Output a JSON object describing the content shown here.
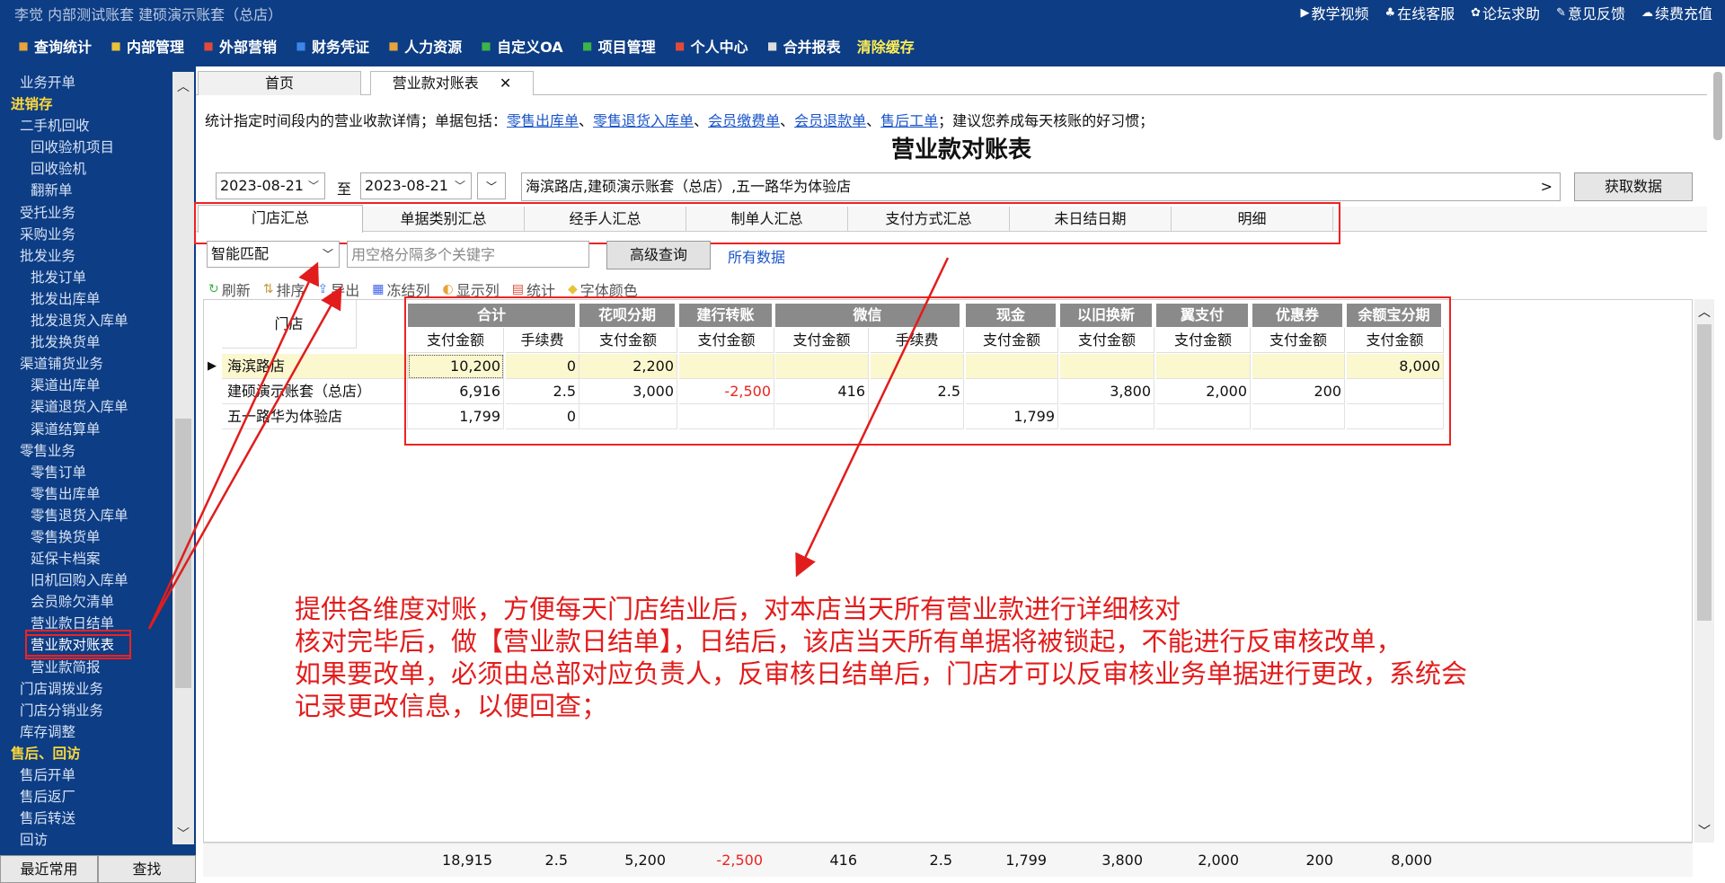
{
  "header": {
    "title": "李觉  内部测试账套    建硕演示账套（总店）",
    "links": [
      {
        "icon": "▶",
        "label": "教学视频"
      },
      {
        "icon": "♣",
        "label": "在线客服"
      },
      {
        "icon": "✿",
        "label": "论坛求助"
      },
      {
        "icon": "✎",
        "label": "意见反馈"
      },
      {
        "icon": "☁",
        "label": "续费充值"
      }
    ]
  },
  "menu": [
    {
      "label": "查询统计",
      "icon": "chart-icon",
      "color": "#e8a33b"
    },
    {
      "label": "内部管理",
      "icon": "pencil-icon",
      "color": "#e8c23b"
    },
    {
      "label": "外部营销",
      "icon": "bag-icon",
      "color": "#e04a3b"
    },
    {
      "label": "财务凭证",
      "icon": "document-icon",
      "color": "#3b86e8"
    },
    {
      "label": "人力资源",
      "icon": "person-icon",
      "color": "#e8a33b"
    },
    {
      "label": "自定义OA",
      "icon": "tools-icon",
      "color": "#3bb44a"
    },
    {
      "label": "项目管理",
      "icon": "gear-icon",
      "color": "#3bb44a"
    },
    {
      "label": "个人中心",
      "icon": "heart-icon",
      "color": "#e04a3b"
    },
    {
      "label": "合并报表",
      "icon": "file-icon",
      "color": "#dddddd"
    },
    {
      "label": "清除缓存",
      "icon": "",
      "color": ""
    }
  ],
  "sidebar": {
    "items": [
      {
        "label": "业务开单",
        "level": 1
      },
      {
        "label": "进销存",
        "level": 0
      },
      {
        "label": "二手机回收",
        "level": 1
      },
      {
        "label": "回收验机项目",
        "level": 2
      },
      {
        "label": "回收验机",
        "level": 2
      },
      {
        "label": "翻新单",
        "level": 2
      },
      {
        "label": "受托业务",
        "level": 1
      },
      {
        "label": "采购业务",
        "level": 1
      },
      {
        "label": "批发业务",
        "level": 1
      },
      {
        "label": "批发订单",
        "level": 2
      },
      {
        "label": "批发出库单",
        "level": 2
      },
      {
        "label": "批发退货入库单",
        "level": 2
      },
      {
        "label": "批发换货单",
        "level": 2
      },
      {
        "label": "渠道铺货业务",
        "level": 1
      },
      {
        "label": "渠道出库单",
        "level": 2
      },
      {
        "label": "渠道退货入库单",
        "level": 2
      },
      {
        "label": "渠道结算单",
        "level": 2
      },
      {
        "label": "零售业务",
        "level": 1
      },
      {
        "label": "零售订单",
        "level": 2
      },
      {
        "label": "零售出库单",
        "level": 2
      },
      {
        "label": "零售退货入库单",
        "level": 2
      },
      {
        "label": "零售换货单",
        "level": 2
      },
      {
        "label": "延保卡档案",
        "level": 2
      },
      {
        "label": "旧机回购入库单",
        "level": 2
      },
      {
        "label": "会员赊欠清单",
        "level": 2
      },
      {
        "label": "营业款日结单",
        "level": 2
      },
      {
        "label": "营业款对账表",
        "level": 2,
        "selected": true
      },
      {
        "label": "营业款简报",
        "level": 2
      },
      {
        "label": "门店调拨业务",
        "level": 1
      },
      {
        "label": "门店分销业务",
        "level": 1
      },
      {
        "label": "库存调整",
        "level": 1
      },
      {
        "label": "售后、回访",
        "level": 0
      },
      {
        "label": "售后开单",
        "level": 1
      },
      {
        "label": "售后返厂",
        "level": 1
      },
      {
        "label": "售后转送",
        "level": 1
      },
      {
        "label": "回访",
        "level": 1
      }
    ],
    "recent_label": "最近常用",
    "find_label": "查找"
  },
  "tabs": {
    "home": "首页",
    "active": "营业款对账表",
    "close": "✕"
  },
  "desc": {
    "prefix": "统计指定时间段内的营业收款详情；单据包括：",
    "links": [
      "零售出库单",
      "零售退货入库单",
      "会员缴费单",
      "会员退款单",
      "售后工单"
    ],
    "sep": "、",
    "suffix": "；建议您养成每天核账的好习惯；"
  },
  "report_title": "营业款对账表",
  "filters": {
    "date_from": "2023-08-21",
    "to": "至",
    "date_to": "2023-08-21",
    "stores": "海滨路店,建硕演示账套（总店）,五一路华为体验店",
    "stores_arrow": ">",
    "fetch": "获取数据"
  },
  "subtabs": [
    "门店汇总",
    "单据类别汇总",
    "经手人汇总",
    "制单人汇总",
    "支付方式汇总",
    "未日结日期",
    "明细"
  ],
  "search": {
    "mode": "智能匹配",
    "placeholder": "用空格分隔多个关键字",
    "advanced": "高级查询",
    "all": "所有数据"
  },
  "toolbar": [
    {
      "icon": "↻",
      "label": "刷新"
    },
    {
      "icon": "⇅",
      "label": "排序"
    },
    {
      "icon": "⇪",
      "label": "导出"
    },
    {
      "icon": "▦",
      "label": "冻结列"
    },
    {
      "icon": "◐",
      "label": "显示列"
    },
    {
      "icon": "▤",
      "label": "统计"
    },
    {
      "icon": "◆",
      "label": "字体颜色"
    }
  ],
  "table": {
    "store_header": "门店",
    "groups": [
      "合计",
      "花呗分期",
      "建行转账",
      "微信",
      "现金",
      "以旧换新",
      "翼支付",
      "优惠券",
      "余额宝分期"
    ],
    "sub": [
      "支付金额",
      "手续费",
      "支付金额",
      "支付金额",
      "支付金额",
      "手续费",
      "支付金额",
      "支付金额",
      "支付金额",
      "支付金额",
      "支付金额"
    ],
    "rows": [
      {
        "name": "海滨路店",
        "cells": [
          "10,200",
          "0",
          "2,200",
          "",
          "",
          "",
          "",
          "",
          "",
          "",
          "8,000"
        ]
      },
      {
        "name": "建硕演示账套（总店）",
        "cells": [
          "6,916",
          "2.5",
          "3,000",
          "-2,500",
          "416",
          "2.5",
          "",
          "3,800",
          "2,000",
          "200",
          ""
        ]
      },
      {
        "name": "五一路华为体验店",
        "cells": [
          "1,799",
          "0",
          "",
          "",
          "",
          "",
          "1,799",
          "",
          "",
          "",
          ""
        ]
      }
    ],
    "totals": [
      "18,915",
      "2.5",
      "5,200",
      "-2,500",
      "416",
      "2.5",
      "1,799",
      "3,800",
      "2,000",
      "200",
      "8,000"
    ]
  },
  "annotation": [
    "提供各维度对账，方便每天门店结业后，对本店当天所有营业款进行详细核对",
    "核对完毕后，做【营业款日结单】，日结后，该店当天所有单据将被锁起，不能进行反审核改单，",
    "如果要改单，必须由总部对应负责人，反审核日结单后，门店才可以反审核业务单据进行更改，系统会",
    "记录更改信息，以便回查；"
  ],
  "colors": {
    "navy": "#0d3d84",
    "annotation": "#e21c1c",
    "negative": "#e22222",
    "link": "#1a55c9"
  }
}
